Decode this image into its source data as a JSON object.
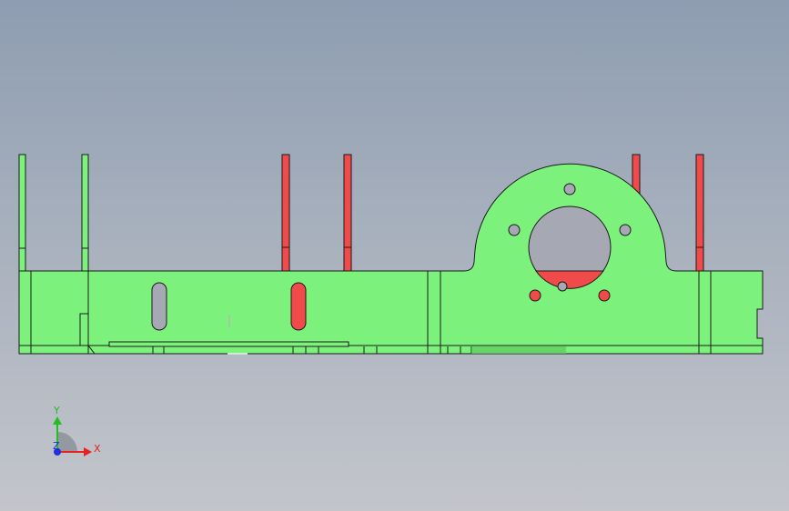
{
  "viewport": {
    "background_top": "#8e9db1",
    "background_bottom": "#c3c5cb"
  },
  "colors": {
    "part_green": "#7cf27c",
    "part_red": "#f04a4a",
    "edge": "#1a1a1a",
    "hole": "#a6a9b4"
  },
  "triad": {
    "x_label": "X",
    "y_label": "Y",
    "z_label": "Z",
    "x_color": "#e82020",
    "y_color": "#20c020",
    "z_color": "#2030e0"
  }
}
